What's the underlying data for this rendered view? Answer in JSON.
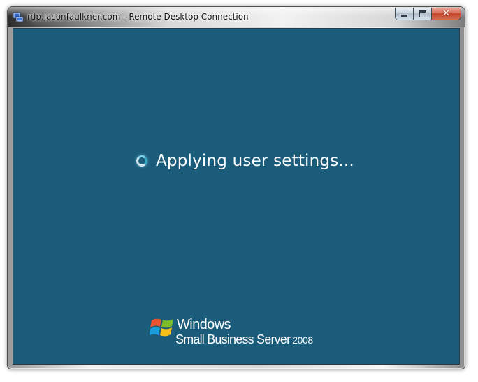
{
  "window": {
    "title": "rdp.jasonfaulkner.com - Remote Desktop Connection",
    "app_icon": "remote-desktop-icon",
    "controls": {
      "minimize_icon": "minimize-icon",
      "maximize_icon": "maximize-icon",
      "close_icon": "close-icon"
    }
  },
  "session": {
    "status_text": "Applying user settings...",
    "status_icon": "loading-spinner-icon",
    "background_color": "#1b5c7b"
  },
  "branding": {
    "logo_icon": "windows-flag-icon",
    "brand_name": "Windows",
    "product_name": "Small Business Server",
    "version": "2008"
  }
}
